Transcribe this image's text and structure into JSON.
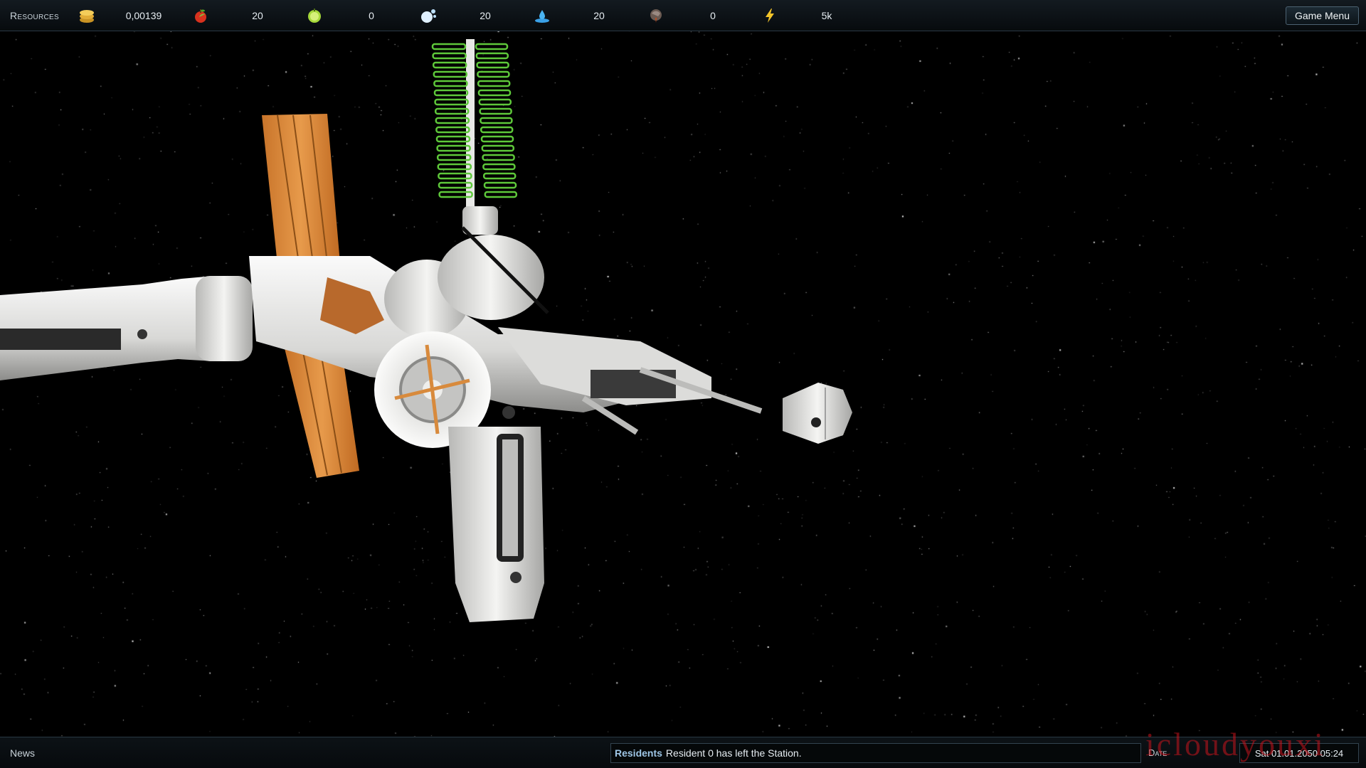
{
  "topbar": {
    "resources_label": "Resources",
    "items": [
      {
        "name": "money",
        "icon": "coins-icon",
        "value": "0,00139"
      },
      {
        "name": "food",
        "icon": "apple-icon",
        "value": "20"
      },
      {
        "name": "oxygen",
        "icon": "lime-icon",
        "value": "0"
      },
      {
        "name": "air",
        "icon": "bubbles-icon",
        "value": "20"
      },
      {
        "name": "water",
        "icon": "water-drop-icon",
        "value": "20"
      },
      {
        "name": "waste",
        "icon": "rock-icon",
        "value": "0"
      },
      {
        "name": "energy",
        "icon": "lightning-icon",
        "value": "5k"
      }
    ],
    "game_menu_label": "Game Menu"
  },
  "bottombar": {
    "news_label": "News",
    "news_category": "Residents",
    "news_text": "Resident 0 has left the Station.",
    "date_label": "Date",
    "date_value": "Sat 01.01.2050 05:24"
  },
  "watermark": "icloudyouxi",
  "colors": {
    "solar_panel_orange": "#d98a3a",
    "radiator_green": "#5ec83a",
    "hull_white": "#e8e8e6"
  }
}
